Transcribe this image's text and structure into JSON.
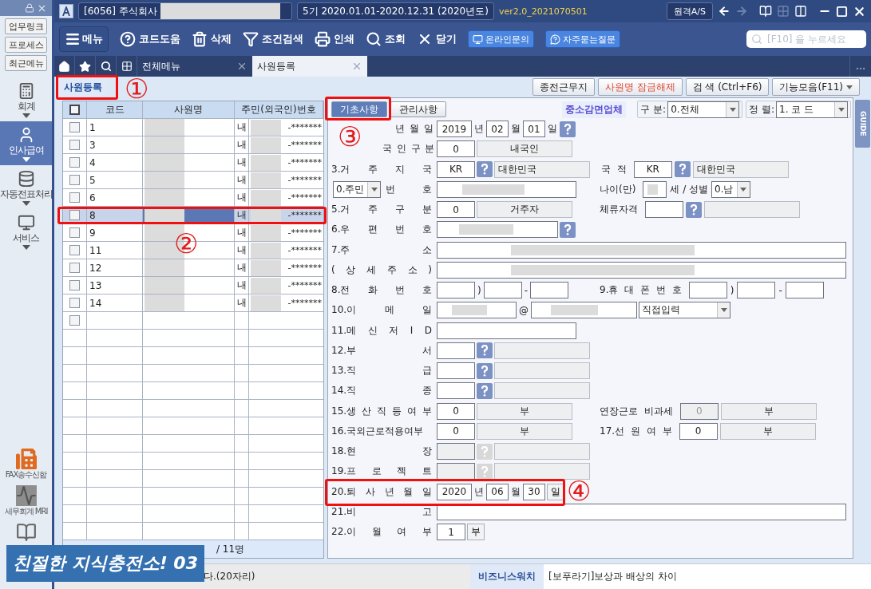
{
  "sidebar": {
    "top_buttons": [
      "업무링크",
      "프로세스",
      "최근메뉴"
    ],
    "nav": [
      {
        "kind": "calculator",
        "label": "회계",
        "selected": false
      },
      {
        "kind": "person",
        "label": "인사급여",
        "selected": true
      },
      {
        "kind": "database",
        "label": "자동전표처리",
        "selected": false
      },
      {
        "kind": "monitor",
        "label": "서비스",
        "selected": false
      }
    ],
    "tools": [
      {
        "kind": "fax",
        "label": "FAX송수신함"
      },
      {
        "kind": "pulse",
        "label": "세무회계 MRI"
      },
      {
        "kind": "book"
      }
    ]
  },
  "title_bar": {
    "company": "[6056] 주식회사",
    "period": "5기 2020.01.01-2020.12.31 (2020년도)",
    "version": "ver2,0_2021070501",
    "remote_button": "원격A/S"
  },
  "toolbar": {
    "menu_button": "메뉴",
    "actions": [
      {
        "kind": "help",
        "label": "코드도움"
      },
      {
        "kind": "trash",
        "label": "삭제"
      },
      {
        "kind": "filter",
        "label": "조건검색"
      },
      {
        "kind": "print",
        "label": "인쇄"
      },
      {
        "kind": "search",
        "label": "조회"
      },
      {
        "kind": "close",
        "label": "닫기"
      }
    ],
    "links": [
      {
        "kind": "monitor",
        "label": "온라인문의"
      },
      {
        "kind": "question",
        "label": "자주묻는질문"
      }
    ],
    "search": {
      "placeholder": "[F10] 을 누르세요"
    }
  },
  "tabs": [
    {
      "label": "전체메뉴",
      "selected": false
    },
    {
      "label": "사원등록",
      "selected": true
    }
  ],
  "page": {
    "title": "사원등록",
    "buttons": [
      {
        "kind": "plain",
        "label": "종전근무지"
      },
      {
        "kind": "alert",
        "label": "사원명 잠금해제"
      },
      {
        "kind": "plain",
        "label": "검 색 (Ctrl+F6)"
      },
      {
        "kind": "dropdown",
        "label": "기능모음(F11)"
      }
    ]
  },
  "employee_table": {
    "columns": [
      "코드",
      "사원명",
      "주민(외국인)번호"
    ],
    "header_checked": false,
    "rows": [
      {
        "code": "1",
        "type": "내",
        "id_suffix": "-*******",
        "checked": false,
        "selected": false
      },
      {
        "code": "3",
        "type": "내",
        "id_suffix": "-*******",
        "checked": false,
        "selected": false
      },
      {
        "code": "4",
        "type": "내",
        "id_suffix": "-*******",
        "checked": false,
        "selected": false
      },
      {
        "code": "5",
        "type": "내",
        "id_suffix": "-*******",
        "checked": false,
        "selected": false
      },
      {
        "code": "6",
        "type": "내",
        "id_suffix": "-*******",
        "checked": false,
        "selected": false
      },
      {
        "code": "8",
        "type": "내",
        "id_suffix": "-*******",
        "checked": false,
        "selected": true
      },
      {
        "code": "9",
        "type": "내",
        "id_suffix": "-*******",
        "checked": false,
        "selected": false
      },
      {
        "code": "11",
        "type": "내",
        "id_suffix": "-*******",
        "checked": false,
        "selected": false
      },
      {
        "code": "12",
        "type": "내",
        "id_suffix": "-*******",
        "checked": false,
        "selected": false
      },
      {
        "code": "13",
        "type": "내",
        "id_suffix": "-*******",
        "checked": false,
        "selected": false
      },
      {
        "code": "14",
        "type": "내",
        "id_suffix": "-*******",
        "checked": false,
        "selected": false
      }
    ],
    "new_row": {
      "checked": false
    },
    "footer": "/ 11명"
  },
  "form": {
    "tabs": [
      {
        "label": "기초사항",
        "selected": true
      },
      {
        "label": "관리사항",
        "selected": false
      }
    ],
    "badge": "중소감면업체",
    "filters": [
      {
        "label": "구 분:",
        "value": "0.전체"
      },
      {
        "label": "정 렬:",
        "value": "1. 코 드"
      }
    ],
    "guide": "GUIDE",
    "rows": [
      {
        "kind": "covered",
        "label": "년 월 일",
        "parts": [
          {
            "kind": "year",
            "value": "2019"
          },
          {
            "kind": "text",
            "text": "년"
          },
          {
            "kind": "day",
            "value": "02"
          },
          {
            "kind": "text",
            "text": "월"
          },
          {
            "kind": "day",
            "value": "01"
          },
          {
            "kind": "text",
            "text": "일"
          },
          {
            "kind": "help"
          }
        ]
      },
      {
        "kind": "covered",
        "label": "국 인 구 분",
        "parts": [
          {
            "kind": "code",
            "value": "0"
          },
          {
            "kind": "display",
            "text": "내국인"
          }
        ]
      },
      {
        "kind": "plain",
        "label": "3.거 주 지 국",
        "parts": [
          {
            "kind": "code",
            "value": "KR"
          },
          {
            "kind": "help"
          },
          {
            "kind": "name",
            "text": "대한민국"
          }
        ],
        "extra": {
          "label": "국 적",
          "parts": [
            {
              "kind": "code",
              "value": "KR"
            },
            {
              "kind": "help"
            },
            {
              "kind": "name",
              "text": "대한민국"
            }
          ]
        }
      },
      {
        "kind": "select",
        "label_select": "0.주민",
        "label": "번 호",
        "parts": [
          {
            "kind": "field",
            "masked": true
          }
        ],
        "extra": {
          "label": "나이(만)",
          "parts": [
            {
              "kind": "tiny",
              "masked": true
            },
            {
              "kind": "text",
              "text": "세 / 성별"
            },
            {
              "kind": "select",
              "value": "0.남"
            }
          ]
        }
      },
      {
        "kind": "plain",
        "label": "5.거 주 구 분",
        "parts": [
          {
            "kind": "code",
            "value": "0"
          },
          {
            "kind": "display",
            "text": "거주자"
          }
        ],
        "extra": {
          "label": "체류자격",
          "parts": [
            {
              "kind": "code"
            },
            {
              "kind": "help"
            },
            {
              "kind": "display"
            }
          ]
        }
      },
      {
        "kind": "plain",
        "label": "6.우 편 번 호",
        "parts": [
          {
            "kind": "zip",
            "masked": true
          },
          {
            "kind": "help"
          }
        ]
      },
      {
        "kind": "plain",
        "label": "7.주 소",
        "parts": [
          {
            "kind": "full",
            "masked": true
          }
        ]
      },
      {
        "kind": "plain",
        "label": "( 상 세 주 소 )",
        "parts": [
          {
            "kind": "full",
            "masked": true
          }
        ]
      },
      {
        "kind": "plain",
        "label": "8.전 화 번 호",
        "parts": [
          {
            "kind": "code"
          },
          {
            "kind": "text",
            "text": ")"
          },
          {
            "kind": "code"
          },
          {
            "kind": "text",
            "text": "-"
          },
          {
            "kind": "code"
          }
        ],
        "extra": {
          "label": "9.휴 대 폰 번 호",
          "parts": [
            {
              "kind": "code"
            },
            {
              "kind": "text",
              "text": ")"
            },
            {
              "kind": "code"
            },
            {
              "kind": "text",
              "text": "-"
            },
            {
              "kind": "code"
            }
          ]
        }
      },
      {
        "kind": "plain",
        "label": "10.이 메 일",
        "parts": [
          {
            "kind": "email",
            "masked": true
          },
          {
            "kind": "text",
            "text": "@"
          },
          {
            "kind": "domain",
            "masked": true
          },
          {
            "kind": "wide-select",
            "value": "직접입력"
          }
        ]
      },
      {
        "kind": "plain",
        "label": "11.메 신 저 I D",
        "parts": [
          {
            "kind": "field",
            "masked": false
          }
        ]
      },
      {
        "kind": "plain",
        "label": "12.부 서",
        "parts": [
          {
            "kind": "code"
          },
          {
            "kind": "help"
          },
          {
            "kind": "display"
          }
        ]
      },
      {
        "kind": "plain",
        "label": "13.직 급",
        "parts": [
          {
            "kind": "code"
          },
          {
            "kind": "help"
          },
          {
            "kind": "display"
          }
        ]
      },
      {
        "kind": "plain",
        "label": "14.직 종",
        "parts": [
          {
            "kind": "code"
          },
          {
            "kind": "help"
          },
          {
            "kind": "display"
          }
        ]
      },
      {
        "kind": "plain",
        "label": "15.생 산 직 등 여 부",
        "parts": [
          {
            "kind": "code",
            "value": "0"
          },
          {
            "kind": "display",
            "text": "부"
          }
        ],
        "extra": {
          "label": "연장근로 비과세",
          "parts": [
            {
              "kind": "code-off",
              "value": "0"
            },
            {
              "kind": "display",
              "text": "부"
            }
          ]
        }
      },
      {
        "kind": "plain",
        "label": "16.국외근로적용여부",
        "parts": [
          {
            "kind": "code",
            "value": "0"
          },
          {
            "kind": "display",
            "text": "부"
          }
        ],
        "extra": {
          "label": "17.선 원 여 부",
          "parts": [
            {
              "kind": "code",
              "value": "0"
            },
            {
              "kind": "display",
              "text": "부"
            }
          ]
        }
      },
      {
        "kind": "plain",
        "label": "18.현 장",
        "parts": [
          {
            "kind": "code-off"
          },
          {
            "kind": "help-off"
          },
          {
            "kind": "display"
          }
        ]
      },
      {
        "kind": "plain",
        "label": "19.프 로 젝 트",
        "parts": [
          {
            "kind": "code-off"
          },
          {
            "kind": "help-off"
          },
          {
            "kind": "display"
          }
        ]
      },
      {
        "kind": "plain",
        "label": "20.퇴 사 년 월 일",
        "parts": [
          {
            "kind": "year",
            "value": "2020"
          },
          {
            "kind": "text",
            "text": "년"
          },
          {
            "kind": "day",
            "value": "06"
          },
          {
            "kind": "text",
            "text": "월"
          },
          {
            "kind": "day",
            "value": "30"
          },
          {
            "kind": "boxed",
            "text": "일"
          }
        ]
      },
      {
        "kind": "plain",
        "label": "21.비 고",
        "parts": [
          {
            "kind": "full",
            "masked": false
          }
        ]
      },
      {
        "kind": "plain",
        "label": "22.이 월 여 부",
        "parts": [
          {
            "kind": "short",
            "value": "1"
          },
          {
            "kind": "boxed",
            "text": "부"
          }
        ]
      }
    ]
  },
  "status_bar": {
    "hint": "다.(20자리)",
    "label": "비즈니스워치",
    "news": "[보푸라기]보상과 배상의 차이"
  },
  "banner": "친절한 지식충전소! 03",
  "annotations": [
    "①",
    "②",
    "③",
    "④"
  ]
}
